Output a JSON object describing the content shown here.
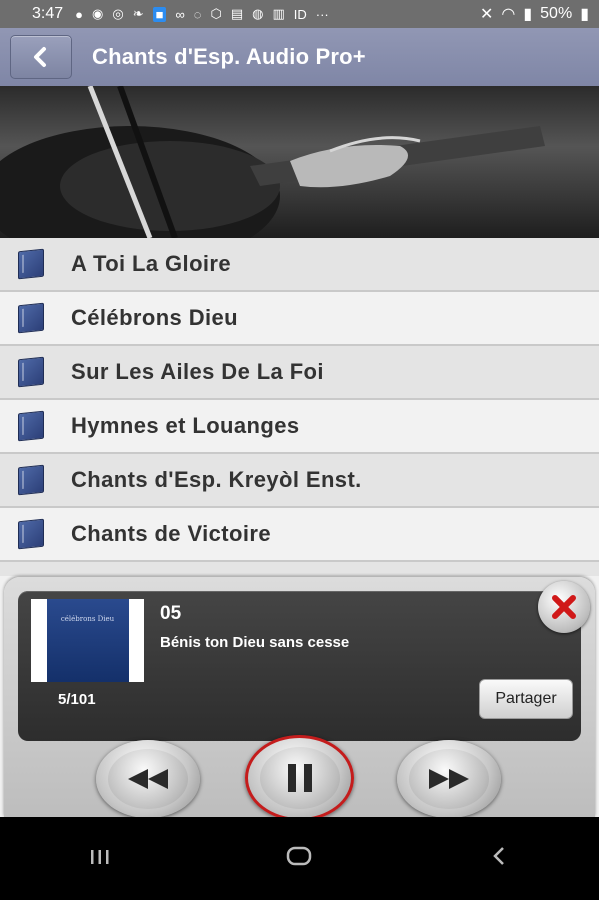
{
  "status_bar": {
    "time": "3:47",
    "battery": "50%",
    "notification_icons": [
      "facebook-icon",
      "messenger-icon",
      "whatsapp-icon",
      "bird-icon",
      "app-icon",
      "voicemail-icon",
      "sync-icon",
      "shield-icon",
      "image-icon",
      "person-icon",
      "news-icon"
    ],
    "id_label": "ID",
    "more": "···"
  },
  "app_bar": {
    "title": "Chants d'Esp. Audio Pro+"
  },
  "songbooks": [
    {
      "label": "A Toi La Gloire"
    },
    {
      "label": "Célébrons Dieu"
    },
    {
      "label": "Sur Les Ailes De La Foi"
    },
    {
      "label": "Hymnes et Louanges"
    },
    {
      "label": "Chants d'Esp. Kreyòl Enst."
    },
    {
      "label": "Chants de Victoire"
    }
  ],
  "player": {
    "track_number": "05",
    "track_title": "Bénis ton Dieu sans cesse",
    "position": "5/101",
    "share_label": "Partager",
    "cover_text": "célébrons Dieu"
  },
  "colors": {
    "app_bar": "#8a90ad",
    "book_icon": "#3a5290",
    "close_x": "#d01818",
    "play_ring": "#c41c1c"
  }
}
